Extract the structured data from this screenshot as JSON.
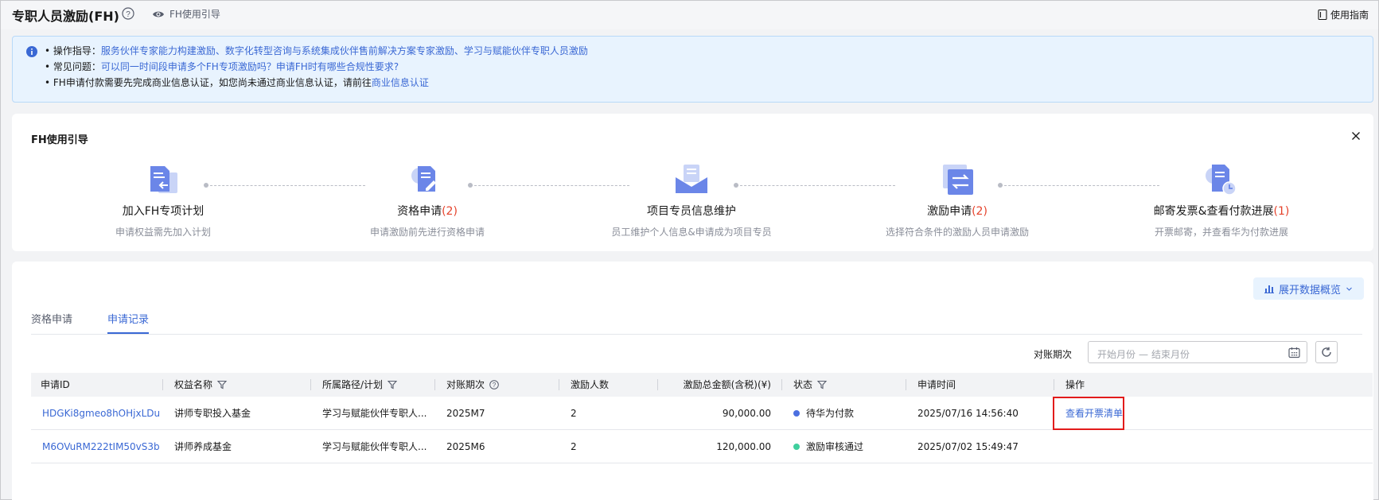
{
  "header": {
    "title": "专职人员激励(FH)",
    "guide_label": "FH使用引导",
    "manual_label": "使用指南"
  },
  "notice": {
    "line1_prefix": "• 操作指导：",
    "line1_link": "服务伙伴专家能力构建激励、数字化转型咨询与系统集成伙伴售前解决方案专家激励、学习与赋能伙伴专职人员激励",
    "line2_prefix": "• 常见问题：",
    "line2_link": "可以同一时间段申请多个FH专项激励吗？申请FH时有哪些合规性要求?",
    "line3_prefix": "• FH申请付款需要先完成商业信息认证，如您尚未通过商业信息认证，请前往",
    "line3_link": "商业信息认证"
  },
  "steps": {
    "title": "FH使用引导",
    "items": [
      {
        "name": "加入FH专项计划",
        "count": "",
        "desc": "申请权益需先加入计划"
      },
      {
        "name": "资格申请",
        "count": "(2)",
        "desc": "申请激励前先进行资格申请"
      },
      {
        "name": "项目专员信息维护",
        "count": "",
        "desc": "员工维护个人信息&申请成为项目专员"
      },
      {
        "name": "激励申请",
        "count": "(2)",
        "desc": "选择符合条件的激励人员申请激励"
      },
      {
        "name": "邮寄发票&查看付款进展",
        "count": "(1)",
        "desc": "开票邮寄，并查看华为付款进展"
      }
    ]
  },
  "main": {
    "overview_label": "展开数据概览",
    "tabs": [
      {
        "label": "资格申请",
        "active": false
      },
      {
        "label": "申请记录",
        "active": true
      }
    ],
    "period_label": "对账期次",
    "period_start_placeholder": "开始月份",
    "period_sep": "—",
    "period_end_placeholder": "结束月份"
  },
  "table": {
    "columns": [
      "申请ID",
      "权益名称",
      "所属路径/计划",
      "对账期次",
      "激励人数",
      "激励总金额(含税)(¥)",
      "状态",
      "申请时间",
      "操作"
    ],
    "rows": [
      {
        "id": "HDGKi8gmeo8hOHjxLDu",
        "benefit": "讲师专职投入基金",
        "path": "学习与赋能伙伴专职人...",
        "period": "2025M7",
        "people": "2",
        "amount": "90,000.00",
        "status": "待华为付款",
        "status_color": "#4b6fe0",
        "time": "2025/07/16 14:56:40",
        "action": "查看开票清单"
      },
      {
        "id": "M6OVuRM222tIM50vS3b",
        "benefit": "讲师养成基金",
        "path": "学习与赋能伙伴专职人...",
        "period": "2025M6",
        "people": "2",
        "amount": "120,000.00",
        "status": "激励审核通过",
        "status_color": "#3fcf9d",
        "time": "2025/07/02 15:49:47",
        "action": ""
      }
    ]
  },
  "colors": {
    "accent": "#3a68d4",
    "count_red": "#e5432c",
    "highlight_red": "#e21b1b"
  }
}
